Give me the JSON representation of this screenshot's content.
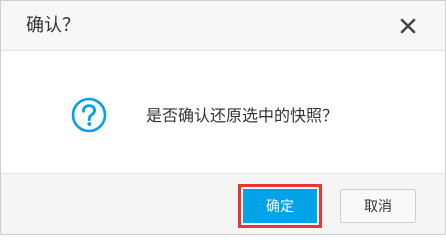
{
  "dialog": {
    "title": "确认？",
    "close_icon": "close-icon",
    "message": "是否确认还原选中的快照？",
    "message_icon": "question-circle-icon",
    "confirm_label": "确定",
    "cancel_label": "取消"
  },
  "colors": {
    "accent": "#00a2e8",
    "highlight": "#e8372f",
    "text": "#333333"
  }
}
